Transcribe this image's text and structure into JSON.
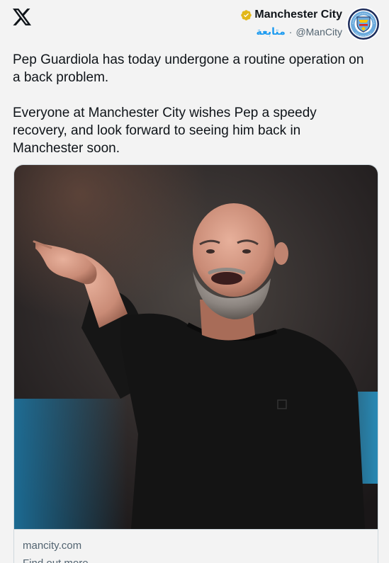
{
  "account": {
    "name": "Manchester City",
    "follow": "متابعة",
    "separator": "·",
    "handle": "@ManCity"
  },
  "tweet": {
    "paragraphs": [
      "Pep Guardiola has today undergone a routine operation on a back problem.",
      "Everyone at Manchester City wishes Pep a speedy recovery, and look forward to seeing him back in Manchester soon."
    ]
  },
  "card": {
    "domain": "mancity.com",
    "cta": "Find out more"
  },
  "colors": {
    "accent": "#1d9bf0",
    "verified": "#e2b719",
    "city_blue": "#6cabdd"
  },
  "icons": {
    "logo": "x-logo-icon",
    "verified": "verified-badge-icon",
    "avatar": "man-city-crest"
  }
}
